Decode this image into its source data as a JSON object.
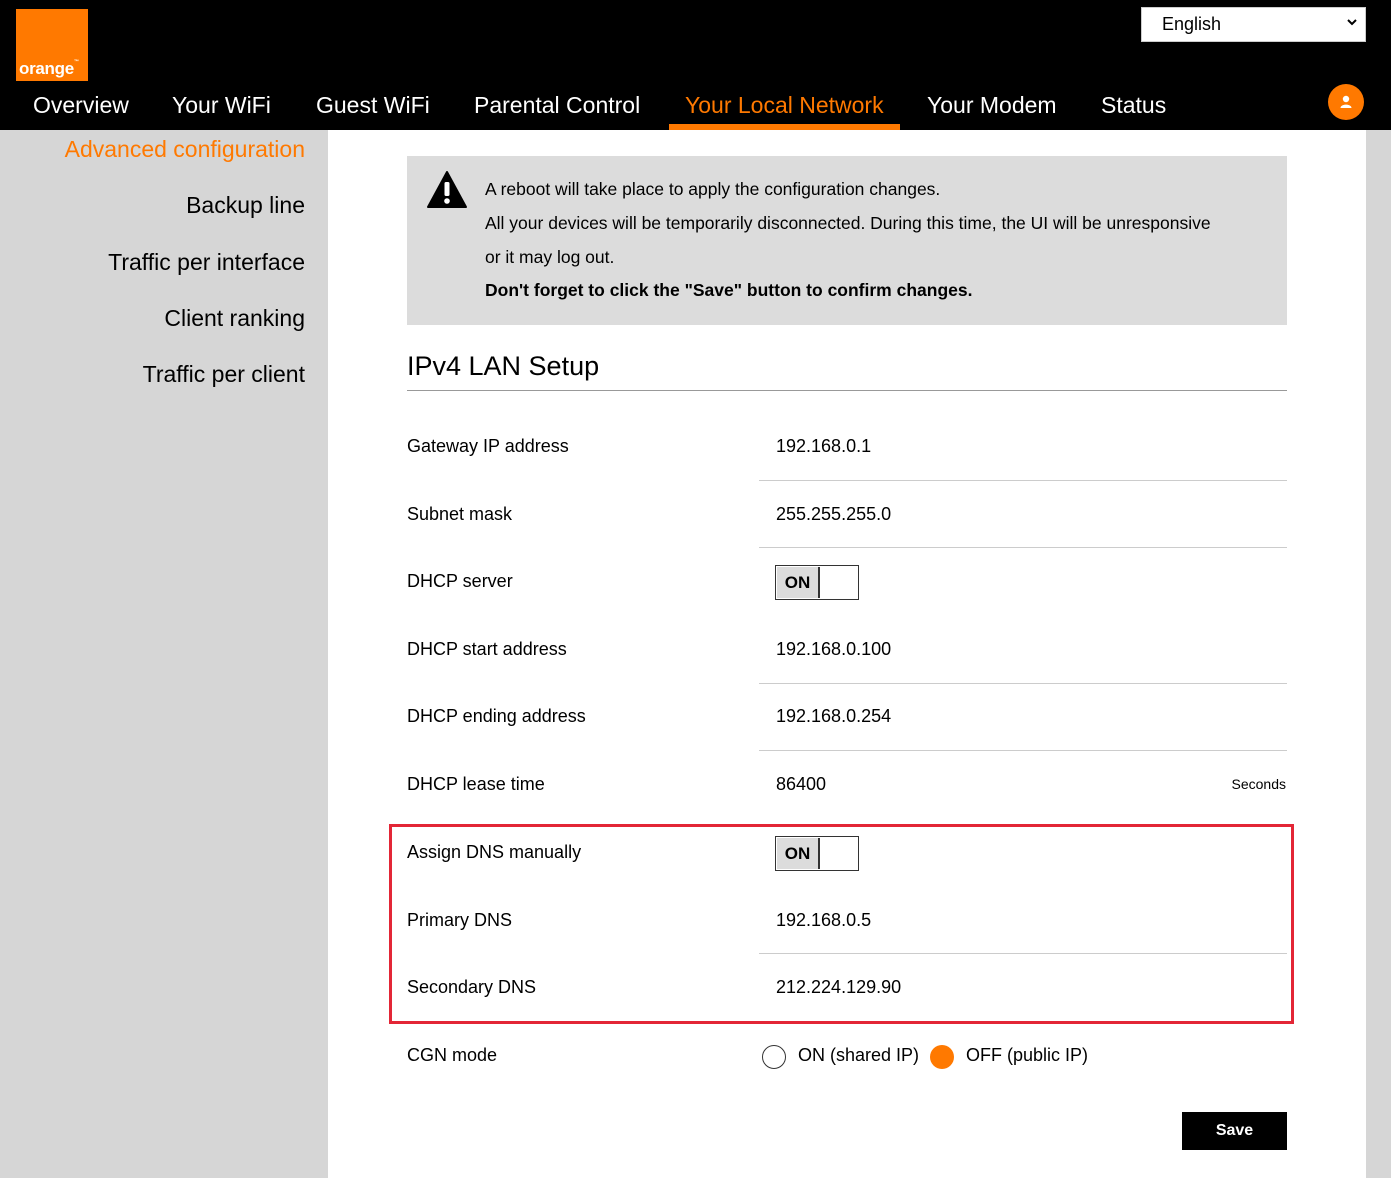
{
  "brand": {
    "logo_text": "orange",
    "logo_tm": "™",
    "color": "#ff7900"
  },
  "language": {
    "selected": "English"
  },
  "nav": {
    "items": [
      {
        "label": "Overview"
      },
      {
        "label": "Your WiFi"
      },
      {
        "label": "Guest WiFi"
      },
      {
        "label": "Parental Control"
      },
      {
        "label": "Your Local Network"
      },
      {
        "label": "Your Modem"
      },
      {
        "label": "Status"
      }
    ],
    "active": "Your Local Network"
  },
  "sidebar": {
    "items": [
      {
        "label": "Advanced configuration"
      },
      {
        "label": "Backup line"
      },
      {
        "label": "Traffic per interface"
      },
      {
        "label": "Client ranking"
      },
      {
        "label": "Traffic per client"
      }
    ],
    "active": "Advanced configuration"
  },
  "warning": {
    "line1": "A reboot will take place to apply the configuration changes.",
    "line2": "All your devices will be temporarily disconnected. During this time, the UI will be unresponsive",
    "line3": "or it may log out.",
    "line4": "Don't forget to click the \"Save\" button to confirm changes."
  },
  "section": {
    "title": "IPv4 LAN Setup"
  },
  "form": {
    "gateway": {
      "label": "Gateway IP address",
      "value": "192.168.0.1"
    },
    "subnet": {
      "label": "Subnet mask",
      "value": "255.255.255.0"
    },
    "dhcp_server": {
      "label": "DHCP server",
      "toggle": "ON"
    },
    "dhcp_start": {
      "label": "DHCP start address",
      "value": "192.168.0.100"
    },
    "dhcp_end": {
      "label": "DHCP ending address",
      "value": "192.168.0.254"
    },
    "lease": {
      "label": "DHCP lease time",
      "value": "86400",
      "unit": "Seconds"
    },
    "assign_dns": {
      "label": "Assign DNS manually",
      "toggle": "ON"
    },
    "primary_dns": {
      "label": "Primary DNS",
      "value": "192.168.0.5"
    },
    "secondary_dns": {
      "label": "Secondary DNS",
      "value": "212.224.129.90"
    },
    "cgn": {
      "label": "CGN mode",
      "option_on": "ON (shared IP)",
      "option_off": "OFF (public IP)",
      "selected": "OFF (public IP)"
    }
  },
  "actions": {
    "save_label": "Save"
  },
  "colors": {
    "highlight": "#e32636",
    "header_bg": "#000000",
    "sidebar_bg": "#d6d6d6"
  }
}
